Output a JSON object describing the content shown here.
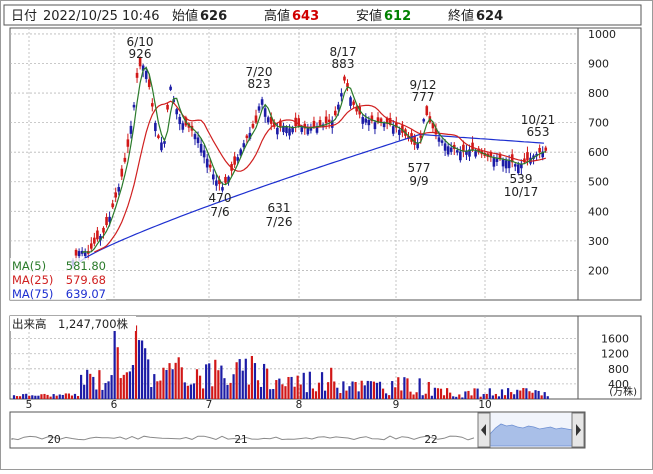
{
  "header": {
    "date_label": "日付",
    "datetime": "2022/10/25 10:46",
    "open_label": "始値",
    "open_value": "626",
    "high_label": "高値",
    "high_value": "643",
    "low_label": "安値",
    "low_value": "612",
    "close_label": "終値",
    "close_value": "624"
  },
  "colors": {
    "up": "#1c1ca6",
    "down": "#d11717",
    "ma5": "#2a7a2a",
    "ma25": "#d02020",
    "ma75": "#1d2fd0",
    "volume_up": "#1c1ca6",
    "volume_down": "#d11717",
    "grid": "#b8b8b8",
    "frame": "#555555",
    "high_text": "#d00000",
    "low_text": "#008000"
  },
  "chart_data": [
    {
      "type": "candlestick",
      "name": "price",
      "ylim": [
        100,
        1020
      ],
      "y_ticks": [
        "1000",
        "900",
        "800",
        "700",
        "600",
        "500",
        "400",
        "300",
        "200"
      ],
      "x_month_labels": [
        "5",
        "6",
        "7",
        "8",
        "9",
        "10"
      ],
      "grid": true,
      "legend": [
        {
          "label": "MA(5)",
          "value": "581.80"
        },
        {
          "label": "MA(25)",
          "value": "579.68"
        },
        {
          "label": "MA(75)",
          "value": "639.07"
        }
      ],
      "annotations": [
        {
          "date": "6/10",
          "value": "926",
          "position": "above"
        },
        {
          "date": "7/20",
          "value": "823",
          "position": "above"
        },
        {
          "date": "8/17",
          "value": "883",
          "position": "above"
        },
        {
          "date": "9/12",
          "value": "777",
          "position": "above"
        },
        {
          "date": "10/21",
          "value": "653",
          "position": "above"
        },
        {
          "date": "7/6",
          "value": "470",
          "position": "below"
        },
        {
          "date": "7/26",
          "value": "631",
          "position": "below"
        },
        {
          "date": "9/9",
          "value": "577",
          "position": "below"
        },
        {
          "date": "10/17",
          "value": "539",
          "position": "below"
        }
      ],
      "series": [
        {
          "name": "MA(5)",
          "values": []
        },
        {
          "name": "MA(25)",
          "values": []
        },
        {
          "name": "MA(75)",
          "values": []
        }
      ]
    },
    {
      "type": "bar",
      "name": "volume",
      "title": "出来高",
      "latest": "1,247,700株",
      "ylim": [
        0,
        2200
      ],
      "y_ticks": [
        "1600",
        "1200",
        "800",
        "400"
      ],
      "unit": "(万株)"
    },
    {
      "type": "area",
      "name": "navigator",
      "x_labels": [
        "20",
        "21",
        "22"
      ]
    }
  ]
}
